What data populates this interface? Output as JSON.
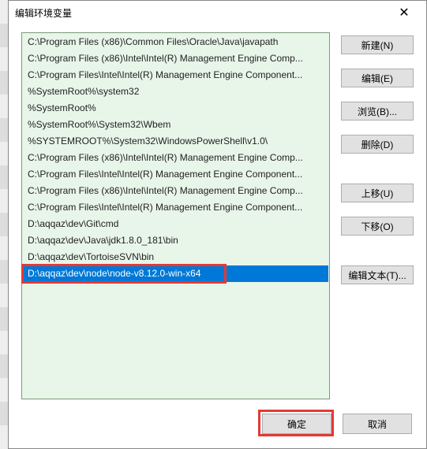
{
  "dialog": {
    "title": "编辑环境变量",
    "close_glyph": "✕"
  },
  "paths": [
    "C:\\Program Files (x86)\\Common Files\\Oracle\\Java\\javapath",
    "C:\\Program Files (x86)\\Intel\\Intel(R) Management Engine Comp...",
    "C:\\Program Files\\Intel\\Intel(R) Management Engine Component...",
    "%SystemRoot%\\system32",
    "%SystemRoot%",
    "%SystemRoot%\\System32\\Wbem",
    "%SYSTEMROOT%\\System32\\WindowsPowerShell\\v1.0\\",
    "C:\\Program Files (x86)\\Intel\\Intel(R) Management Engine Comp...",
    "C:\\Program Files\\Intel\\Intel(R) Management Engine Component...",
    "C:\\Program Files (x86)\\Intel\\Intel(R) Management Engine Comp...",
    "C:\\Program Files\\Intel\\Intel(R) Management Engine Component...",
    "D:\\aqqaz\\dev\\Git\\cmd",
    "D:\\aqqaz\\dev\\Java\\jdk1.8.0_181\\bin",
    "D:\\aqqaz\\dev\\TortoiseSVN\\bin",
    "D:\\aqqaz\\dev\\node\\node-v8.12.0-win-x64"
  ],
  "selected_index": 14,
  "buttons": {
    "new": "新建(N)",
    "edit": "编辑(E)",
    "browse": "浏览(B)...",
    "delete": "删除(D)",
    "move_up": "上移(U)",
    "move_down": "下移(O)",
    "edit_text": "编辑文本(T)...",
    "ok": "确定",
    "cancel": "取消"
  }
}
